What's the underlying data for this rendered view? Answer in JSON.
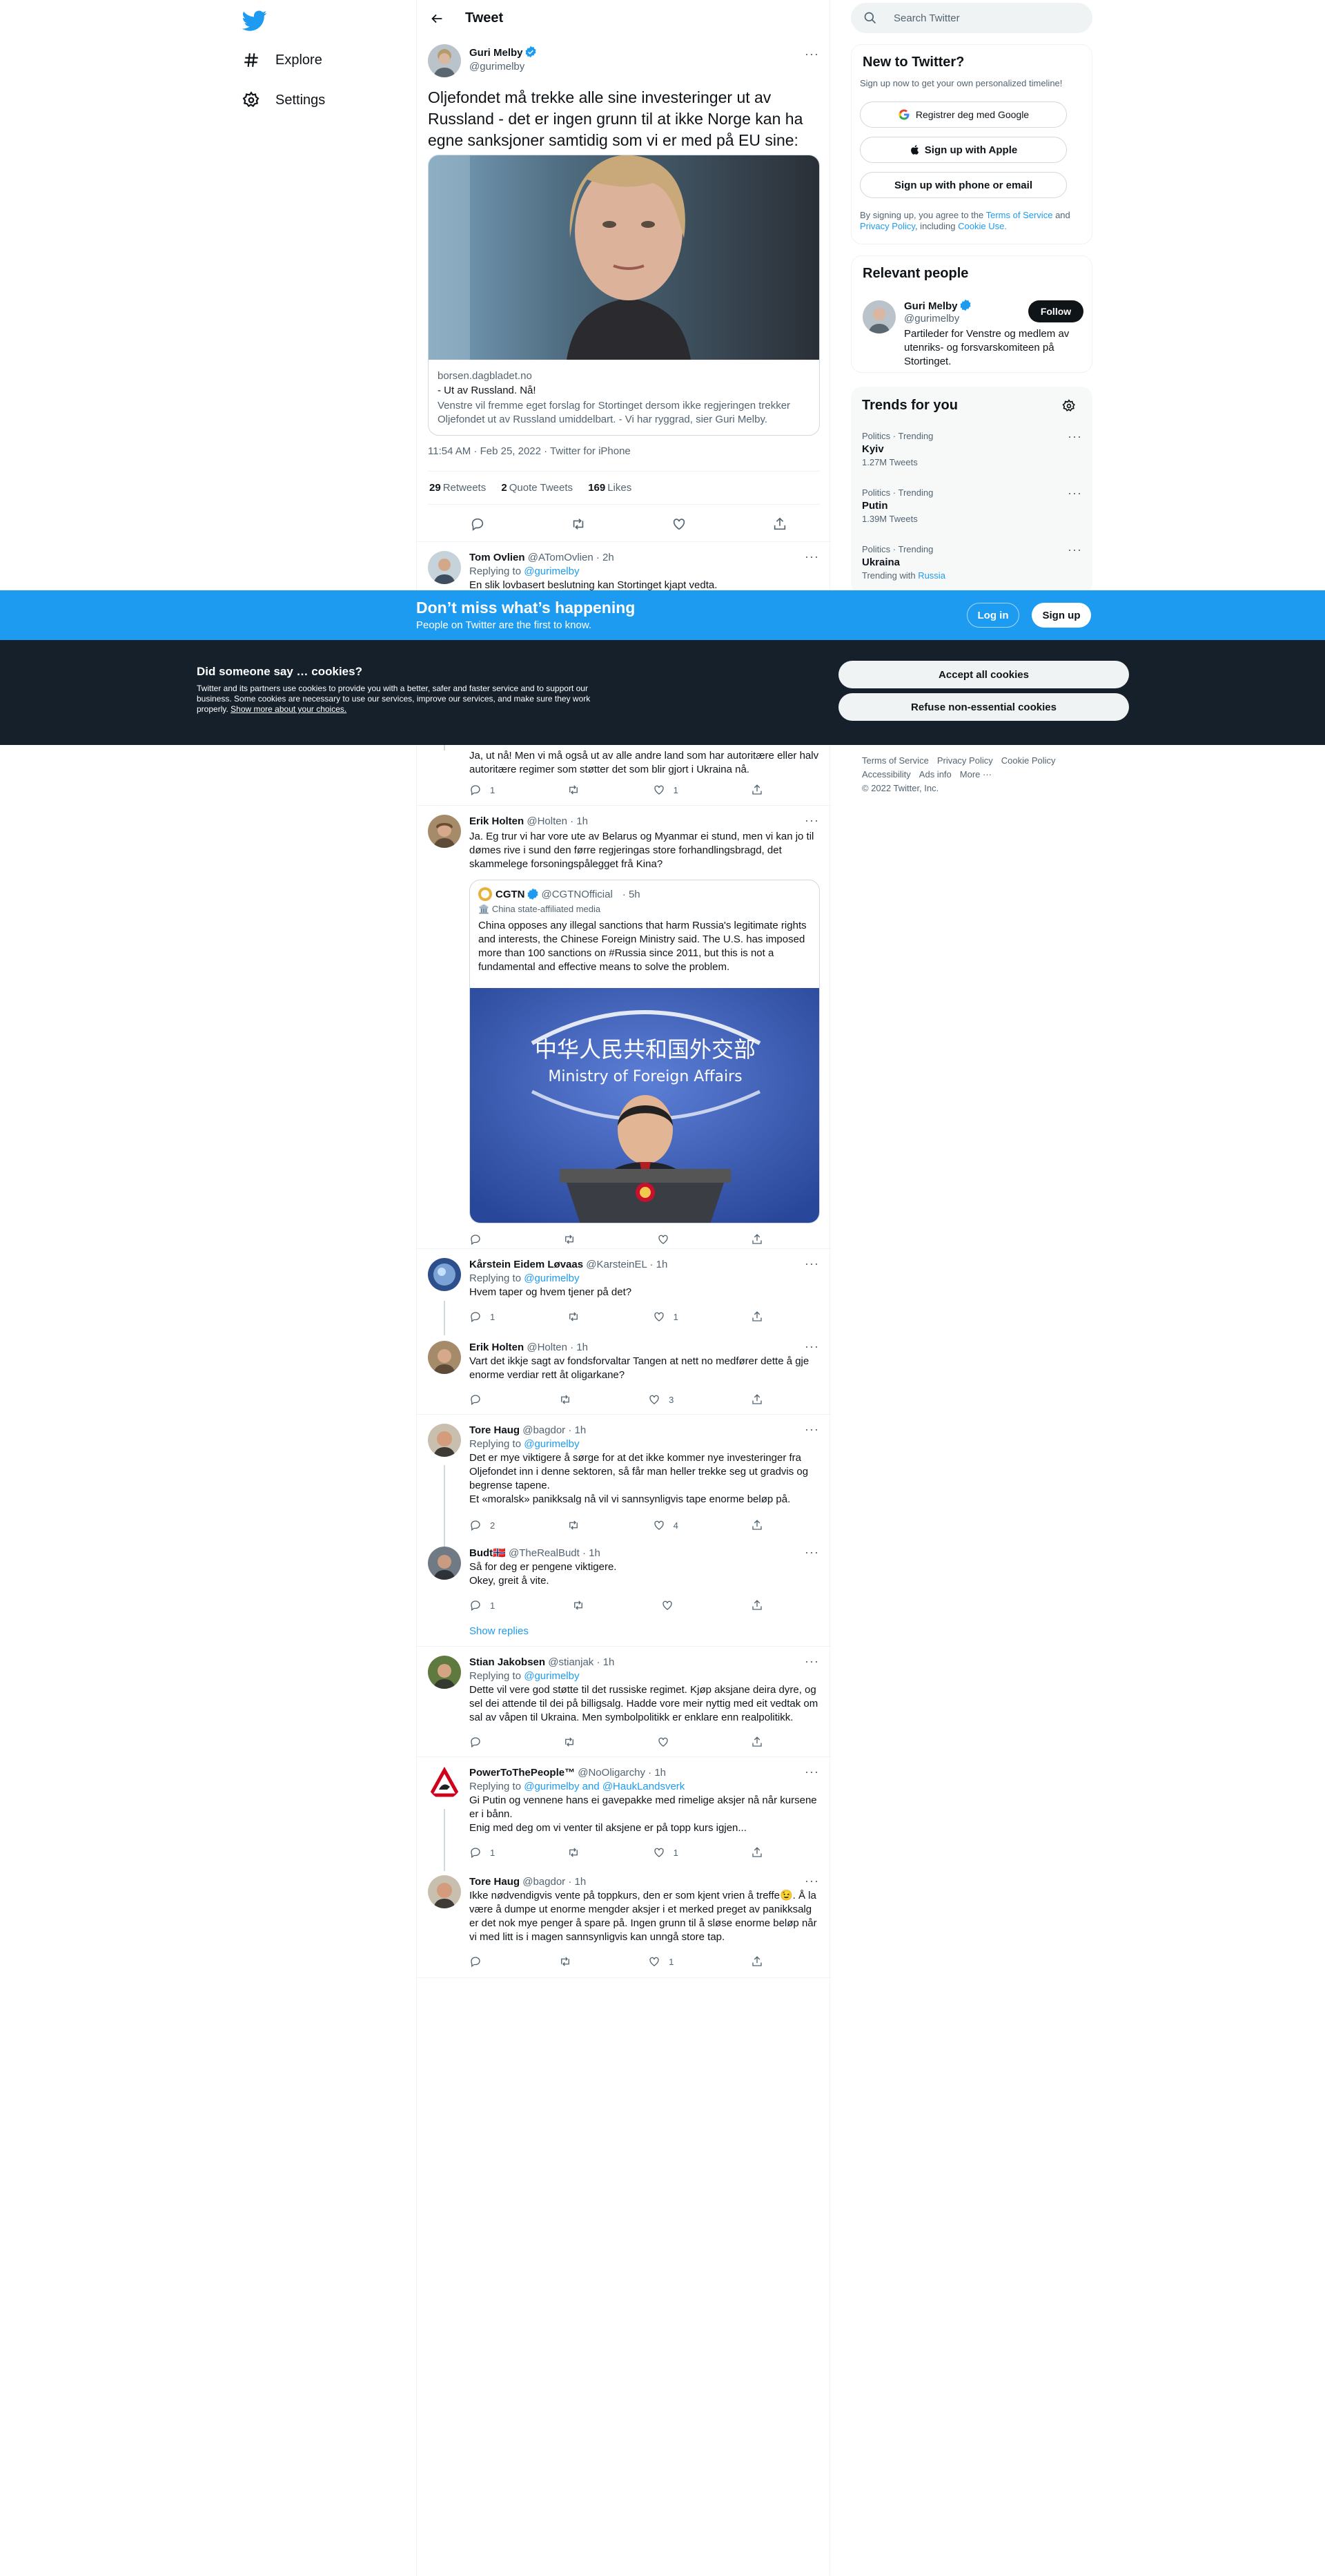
{
  "nav": {
    "explore": "Explore",
    "settings": "Settings"
  },
  "header": {
    "title": "Tweet"
  },
  "tweet": {
    "name": "Guri Melby",
    "handle": "@gurimelby",
    "text": "Oljefondet må trekke alle sine investeringer ut av Russland - det er ingen grunn til at ikke Norge kan ha egne sanksjoner samtidig som vi er med på EU sine:",
    "card": {
      "domain": "borsen.dagbladet.no",
      "title": "- Ut av Russland. Nå!",
      "desc": "Venstre vil fremme eget forslag for Stortinget dersom ikke regjeringen trekker Oljefondet ut av Russland umiddelbart. - Vi har ryggrad, sier Guri Melby."
    },
    "time": "11:54 AM · Feb 25, 2022 · Twitter for iPhone",
    "retweets": "29",
    "retweets_label": "Retweets",
    "quotes": "2",
    "quotes_label": "Quote Tweets",
    "likes": "169",
    "likes_label": "Likes"
  },
  "replies": [
    {
      "name": "Tom Ovlien",
      "handle": "@ATomOvlien · 2h",
      "replying": "Replying to",
      "to": "@gurimelby",
      "text": "En slik lovbasert beslutning kan Stortinget kjapt vedta."
    },
    {
      "text": "Ja, ut nå! Men vi må også ut av alle andre land som har autoritære eller halv autoritære regimer som støtter det som blir gjort i Ukraina nå.",
      "replies": "1",
      "likes": "1"
    },
    {
      "name": "Erik Holten",
      "handle": "@Holten · 1h",
      "text": "Ja. Eg trur vi har vore ute av Belarus og Myanmar ei stund, men vi kan jo til dømes rive i sund den førre regjeringas store forhandlingsbragd, det skammelege forsoningspålegget frå Kina?",
      "quote": {
        "name": "CGTN",
        "handle": "@CGTNOfficial",
        "time": "· 5h",
        "label": "China state-affiliated media",
        "text": "China opposes any illegal sanctions that harm Russia's legitimate rights and interests, the Chinese Foreign Ministry said. The U.S. has imposed more than 100 sanctions on #Russia since 2011, but this is not a fundamental and effective means to solve the problem.",
        "img_cn": "中华人民共和国外交部",
        "img_en": "Ministry of Foreign Affairs"
      }
    },
    {
      "name": "Kårstein Eidem Løvaas",
      "handle": "@KarsteinEL · 1h",
      "replying": "Replying to",
      "to": "@gurimelby",
      "text": "Hvem taper og hvem tjener på det?",
      "replies": "1",
      "likes": "1"
    },
    {
      "name": "Erik Holten",
      "handle": "@Holten · 1h",
      "text": "Vart det ikkje sagt av fondsforvaltar Tangen at nett no medfører dette å gje enorme verdiar rett åt oligarkane?",
      "likes": "3"
    },
    {
      "name": "Tore Haug",
      "handle": "@bagdor · 1h",
      "replying": "Replying to",
      "to": "@gurimelby",
      "text": "Det er mye viktigere å sørge for at det ikke kommer nye investeringer fra Oljefondet inn i denne sektoren, så får man heller trekke seg ut gradvis og begrense tapene.",
      "text2": "Et «moralsk» panikksalg nå vil vi sannsynligvis tape enorme beløp på.",
      "replies": "2",
      "likes": "4"
    },
    {
      "name": "Budt🇳🇴",
      "handle": "@TheRealBudt · 1h",
      "text": "Så for deg er pengene viktigere.",
      "text2": "Okey, greit å vite.",
      "replies": "1",
      "show": "Show replies"
    },
    {
      "name": "Stian Jakobsen",
      "handle": "@stianjak · 1h",
      "replying": "Replying to",
      "to": "@gurimelby",
      "text": "Dette vil vere god støtte til det russiske regimet. Kjøp aksjane deira dyre, og sel dei attende til dei på billigsalg. Hadde vore meir nyttig med eit vedtak om sal av våpen til Ukraina. Men symbolpolitikk er enklare enn realpolitikk."
    },
    {
      "name": "PowerToThePeople™",
      "handle": "@NoOligarchy · 1h",
      "replying": "Replying to",
      "to": "@gurimelby and @HaukLandsverk",
      "text": "Gi Putin og vennene hans ei gavepakke med rimelige aksjer nå når kursene er i bånn.",
      "text2": "Enig med deg om vi venter til aksjene er på topp kurs igjen...",
      "replies": "1",
      "likes": "1"
    },
    {
      "name": "Tore Haug",
      "handle": "@bagdor · 1h",
      "text": "Ikke nødvendigvis vente på toppkurs, den er som kjent vrien å treffe😉. Å la være å dumpe ut enorme mengder aksjer i et merked preget av panikksalg er det nok mye penger å spare på. Ingen grunn til å sløse enorme beløp når vi med litt is i magen sannsynligvis kan unngå store tap.",
      "likes": "1"
    }
  ],
  "search": {
    "placeholder": "Search Twitter"
  },
  "newto": {
    "title": "New to Twitter?",
    "sub": "Sign up now to get your own personalized timeline!",
    "google": "Registrer deg med Google",
    "apple": "Sign up with Apple",
    "phone": "Sign up with phone or email",
    "legal1": "By signing up, you agree to the",
    "tos": "Terms of Service",
    "and": "and",
    "privacy": "Privacy Policy",
    "including": ", including",
    "cookie": "Cookie Use."
  },
  "relevant": {
    "title": "Relevant people",
    "name": "Guri Melby",
    "handle": "@gurimelby",
    "follow": "Follow",
    "bio": "Partileder for Venstre og medlem av utenriks- og forsvarskomiteen på Stortinget."
  },
  "trends": {
    "title": "Trends for you",
    "items": [
      {
        "ctx": "Politics · Trending",
        "name": "Kyiv",
        "count": "1.27M Tweets"
      },
      {
        "ctx": "Politics · Trending",
        "name": "Putin",
        "count": "1.39M Tweets"
      },
      {
        "ctx": "Politics · Trending",
        "name": "Ukraina",
        "count": "Trending with",
        "with": "Russia"
      }
    ]
  },
  "footer": {
    "l1": "Terms of Service",
    "l2": "Privacy Policy",
    "l3": "Cookie Policy",
    "l4": "Accessibility",
    "l5": "Ads info",
    "l6": "More ···",
    "copy": "© 2022 Twitter, Inc."
  },
  "signup_bar": {
    "title": "Don’t miss what’s happening",
    "sub": "People on Twitter are the first to know.",
    "login": "Log in",
    "signup": "Sign up"
  },
  "cookies": {
    "title": "Did someone say … cookies?",
    "text": "Twitter and its partners use cookies to provide you with a better, safer and faster service and to support our business. Some cookies are necessary to use our services, improve our services, and make sure they work properly.",
    "link": "Show more about your choices.",
    "accept": "Accept all cookies",
    "refuse": "Refuse non-essential cookies"
  },
  "colors": {
    "brand": "#1d9bf0",
    "dark": "#0f1419",
    "banner": "#15202b"
  }
}
